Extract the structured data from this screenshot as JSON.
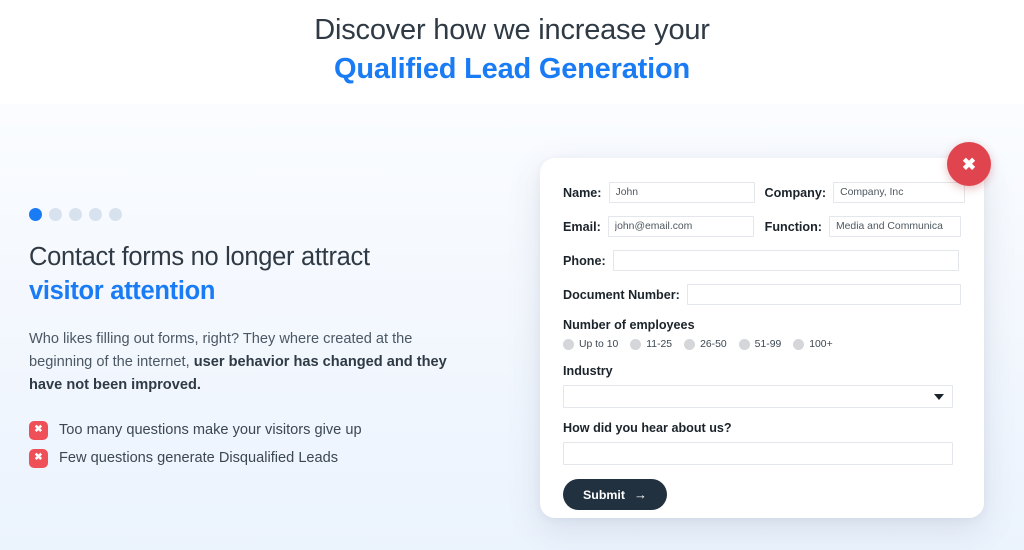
{
  "header": {
    "line1": "Discover how we increase your",
    "line2": "Qualified Lead Generation"
  },
  "left": {
    "pagination": {
      "total": 5,
      "active_index": 0
    },
    "title_line1": "Contact forms no longer attract",
    "title_line2": "visitor attention",
    "body_part1": "Who likes filling out forms, right? They where created at the beginning of the internet, ",
    "body_bold": "user behavior has changed and they have not been improved.",
    "bullets": [
      {
        "icon": "x-icon",
        "text": "Too many questions make your visitors give up"
      },
      {
        "icon": "x-icon",
        "text": "Few questions generate Disqualified Leads"
      }
    ]
  },
  "form": {
    "close_label": "✖",
    "fields": {
      "name": {
        "label": "Name:",
        "value": "John"
      },
      "company": {
        "label": "Company:",
        "value": "Company, Inc"
      },
      "email": {
        "label": "Email:",
        "value": "john@email.com"
      },
      "function": {
        "label": "Function:",
        "value": "Media and Communica"
      },
      "phone": {
        "label": "Phone:",
        "value": ""
      },
      "document": {
        "label": "Document Number:",
        "value": ""
      }
    },
    "employees": {
      "label": "Number of employees",
      "options": [
        "Up to 10",
        "11-25",
        "26-50",
        "51-99",
        "100+"
      ]
    },
    "industry": {
      "label": "Industry",
      "value": ""
    },
    "hear_about": {
      "label": "How did you hear about us?",
      "value": ""
    },
    "submit": {
      "label": "Submit",
      "arrow": "→"
    }
  },
  "colors": {
    "accent_blue": "#1a7cf5",
    "close_red": "#e0454f",
    "bullet_red": "#ef4f56",
    "submit_navy": "#22313f"
  }
}
